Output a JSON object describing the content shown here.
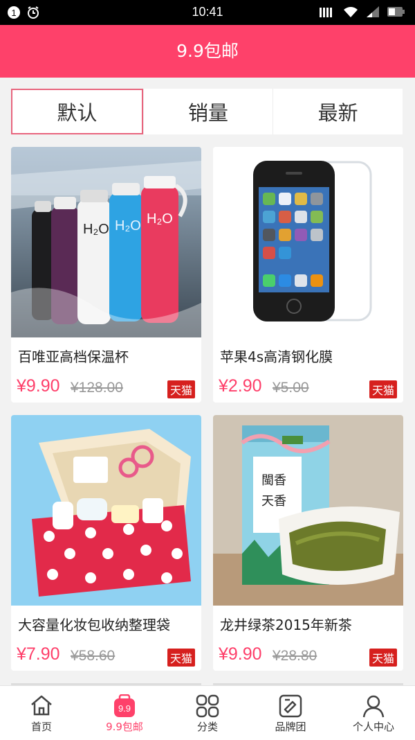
{
  "status_bar": {
    "time": "10:41",
    "notification_badge": "1"
  },
  "header": {
    "title": "9.9包邮"
  },
  "tabs": [
    {
      "label": "默认",
      "active": true
    },
    {
      "label": "销量",
      "active": false
    },
    {
      "label": "最新",
      "active": false
    }
  ],
  "products": [
    {
      "name": "百唯亚高档保温杯",
      "price": "¥9.90",
      "original_price": "¥128.00",
      "badge": "天猫",
      "image_icon": "thermos-bottles-image"
    },
    {
      "name": "苹果4s高清钢化膜",
      "price": "¥2.90",
      "original_price": "¥5.00",
      "badge": "天猫",
      "image_icon": "phone-screen-protector-image"
    },
    {
      "name": "大容量化妆包收纳整理袋",
      "price": "¥7.90",
      "original_price": "¥58.60",
      "badge": "天猫",
      "image_icon": "cosmetic-bag-image"
    },
    {
      "name": "龙井绿茶2015年新茶",
      "price": "¥9.90",
      "original_price": "¥28.80",
      "badge": "天猫",
      "image_icon": "green-tea-image"
    }
  ],
  "bottom_nav": [
    {
      "label": "首页",
      "icon": "home-icon",
      "active": false
    },
    {
      "label": "9.9包邮",
      "icon": "price-tag-icon",
      "icon_text": "9.9",
      "active": true
    },
    {
      "label": "分类",
      "icon": "category-grid-icon",
      "active": false
    },
    {
      "label": "品牌团",
      "icon": "brand-icon",
      "active": false
    },
    {
      "label": "个人中心",
      "icon": "user-icon",
      "active": false
    }
  ],
  "colors": {
    "accent": "#fe416a",
    "price": "#fe3f6a",
    "badge": "#d6201e"
  }
}
